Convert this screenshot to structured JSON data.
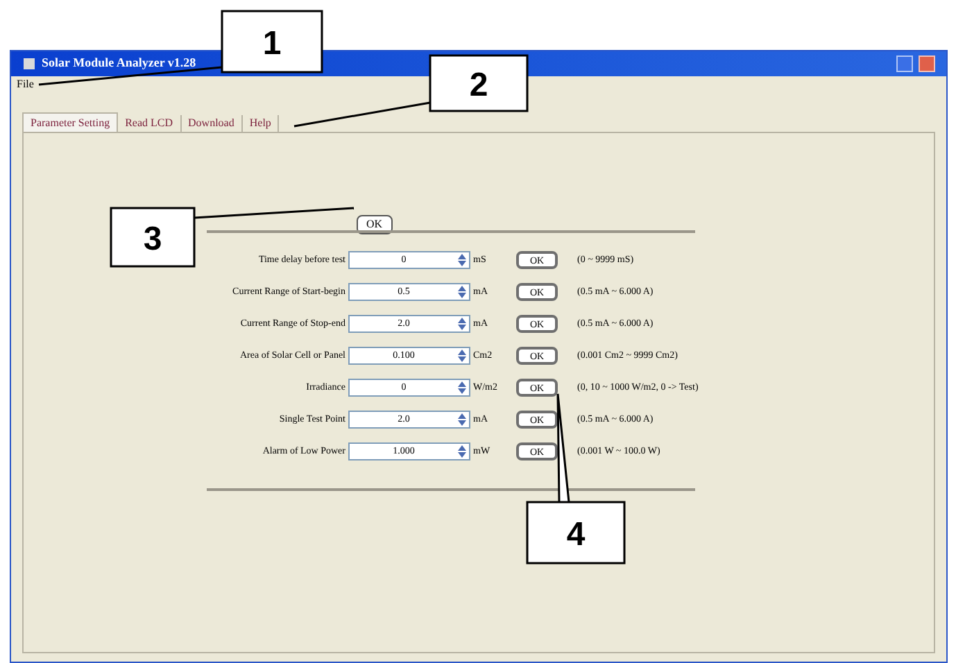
{
  "window": {
    "title": "Solar Module Analyzer v1.28"
  },
  "menu": [
    "File"
  ],
  "tabs": [
    {
      "label": "Parameter Setting",
      "selected": true
    },
    {
      "label": "Read LCD",
      "selected": false
    },
    {
      "label": "Download",
      "selected": false
    },
    {
      "label": "Help",
      "selected": false
    }
  ],
  "top_button": "OK",
  "rows": [
    {
      "label": "Time delay before test",
      "value": "0",
      "unit": "mS",
      "button": "OK",
      "range": "(0 ~ 9999 mS)"
    },
    {
      "label": "Current Range of Start-begin",
      "value": "0.5",
      "unit": "mA",
      "button": "OK",
      "range": "(0.5 mA ~ 6.000 A)"
    },
    {
      "label": "Current Range of Stop-end",
      "value": "2.0",
      "unit": "mA",
      "button": "OK",
      "range": "(0.5 mA ~ 6.000 A)"
    },
    {
      "label": "Area of Solar Cell or Panel",
      "value": "0.100",
      "unit": "Cm2",
      "button": "OK",
      "range": "(0.001 Cm2 ~ 9999 Cm2)"
    },
    {
      "label": "Irradiance",
      "value": "0",
      "unit": "W/m2",
      "button": "OK",
      "range": "(0, 10 ~ 1000 W/m2, 0 -> Test)"
    },
    {
      "label": "Single Test Point",
      "value": "2.0",
      "unit": "mA",
      "button": "OK",
      "range": "(0.5 mA ~ 6.000 A)"
    },
    {
      "label": "Alarm of Low Power",
      "value": "1.000",
      "unit": "mW",
      "button": "OK",
      "range": "(0.001 W ~ 100.0 W)"
    }
  ],
  "callouts": [
    "1",
    "2",
    "3",
    "4"
  ]
}
